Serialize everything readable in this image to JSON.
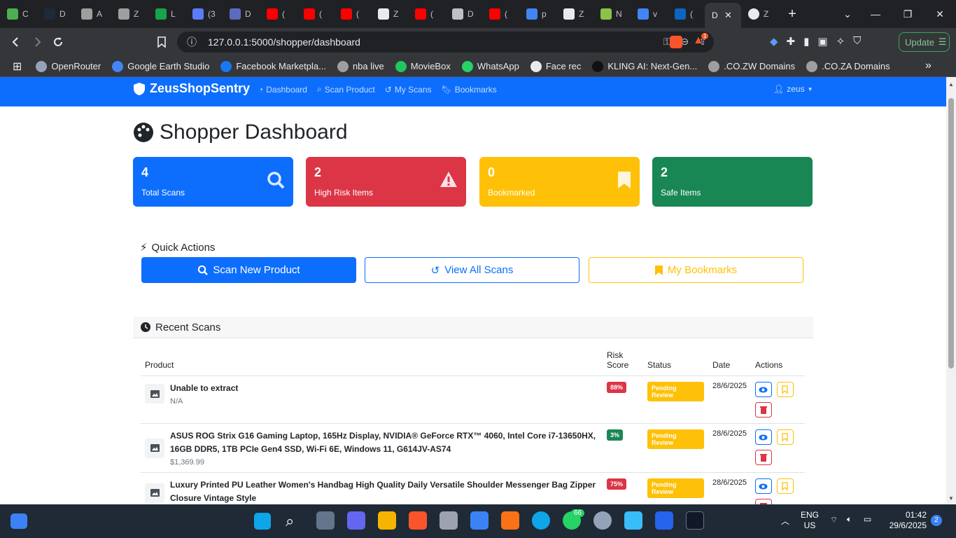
{
  "browser": {
    "tabs": [
      {
        "label": "C",
        "color": "#4caf50"
      },
      {
        "label": "D",
        "color": "#1e293b"
      },
      {
        "label": "A",
        "color": "#9e9e9e"
      },
      {
        "label": "Z",
        "color": "#9e9e9e"
      },
      {
        "label": "L",
        "color": "#16a34a"
      },
      {
        "label": "(3",
        "color": "#5b7cfa"
      },
      {
        "label": "D",
        "color": "#5c6bc0"
      },
      {
        "label": "(",
        "color": "#ff0000"
      },
      {
        "label": "(",
        "color": "#ff0000"
      },
      {
        "label": "(",
        "color": "#ff0000"
      },
      {
        "label": "Z",
        "color": "#e8eaed"
      },
      {
        "label": "(",
        "color": "#ff0000"
      },
      {
        "label": "D",
        "color": "#bdc1c6"
      },
      {
        "label": "(",
        "color": "#ff0000"
      },
      {
        "label": "p",
        "color": "#4285f4"
      },
      {
        "label": "Z",
        "color": "#e8eaed"
      },
      {
        "label": "N",
        "color": "#8bc34a"
      },
      {
        "label": "v",
        "color": "#4285f4"
      },
      {
        "label": "(",
        "color": "#0a66c2"
      }
    ],
    "active_tab": {
      "label": "D"
    },
    "last_tab": {
      "label": "Z"
    },
    "url": "127.0.0.1:5000/shopper/dashboard",
    "brave_badge": "1",
    "update_label": "Update",
    "bookmarks": [
      {
        "label": "OpenRouter",
        "color": "#94a3b8"
      },
      {
        "label": "Google Earth Studio",
        "color": "#4285f4"
      },
      {
        "label": "Facebook Marketpla...",
        "color": "#1877f2"
      },
      {
        "label": "nba live",
        "color": "#9e9e9e"
      },
      {
        "label": "MovieBox",
        "color": "#22c55e"
      },
      {
        "label": "WhatsApp",
        "color": "#25d366"
      },
      {
        "label": "Face rec",
        "color": "#e8eaed"
      },
      {
        "label": "KLING AI: Next-Gen...",
        "color": "#111111"
      },
      {
        "label": ".CO.ZW Domains",
        "color": "#9e9e9e"
      },
      {
        "label": ".CO.ZA Domains",
        "color": "#9e9e9e"
      }
    ]
  },
  "app": {
    "brand": "ZeusShopSentry",
    "nav": [
      {
        "label": "Dashboard",
        "icon": "tachometer-icon"
      },
      {
        "label": "Scan Product",
        "icon": "search-icon"
      },
      {
        "label": "My Scans",
        "icon": "history-icon"
      },
      {
        "label": "Bookmarks",
        "icon": "bookmark-icon"
      }
    ],
    "user": "zeus",
    "title": "Shopper Dashboard",
    "stats": [
      {
        "value": "4",
        "label": "Total Scans",
        "color": "#0d6efd",
        "icon": "search-icon"
      },
      {
        "value": "2",
        "label": "High Risk Items",
        "color": "#dc3545",
        "icon": "warning-icon"
      },
      {
        "value": "0",
        "label": "Bookmarked",
        "color": "#ffc107",
        "icon": "bookmark-icon"
      },
      {
        "value": "2",
        "label": "Safe Items",
        "color": "#198754",
        "icon": "shield-icon"
      }
    ],
    "quick_actions": {
      "title": "Quick Actions",
      "scan_new": "Scan New Product",
      "view_all": "View All Scans",
      "bookmarks": "My Bookmarks"
    },
    "recent": {
      "title": "Recent Scans",
      "headers": {
        "product": "Product",
        "risk_line1": "Risk",
        "risk_line2": "Score",
        "status": "Status",
        "date": "Date",
        "actions": "Actions"
      },
      "rows": [
        {
          "name": "Unable to extract",
          "price": "N/A",
          "risk": "88%",
          "risk_color": "#dc3545",
          "status": "Pending Review",
          "date": "28/6/2025"
        },
        {
          "name": "ASUS ROG Strix G16 Gaming Laptop, 165Hz Display, NVIDIA® GeForce RTX™ 4060, Intel Core i7-13650HX, 16GB DDR5, 1TB PCIe Gen4 SSD, Wi-Fi 6E, Windows 11, G614JV-AS74",
          "price": "$1,369.99",
          "risk": "3%",
          "risk_color": "#198754",
          "status": "Pending Review",
          "date": "28/6/2025"
        },
        {
          "name": "Luxury Printed PU Leather Women's Handbag High Quality Daily Versatile Shoulder Messenger Bag Zipper Closure Vintage Style",
          "price": "",
          "risk": "75%",
          "risk_color": "#dc3545",
          "status": "Pending Review",
          "date": "28/6/2025"
        }
      ]
    }
  },
  "taskbar": {
    "language": "ENG",
    "region": "US",
    "time": "01:42",
    "date": "29/6/2025",
    "notifications": "2",
    "whatsapp_badge": "66"
  }
}
